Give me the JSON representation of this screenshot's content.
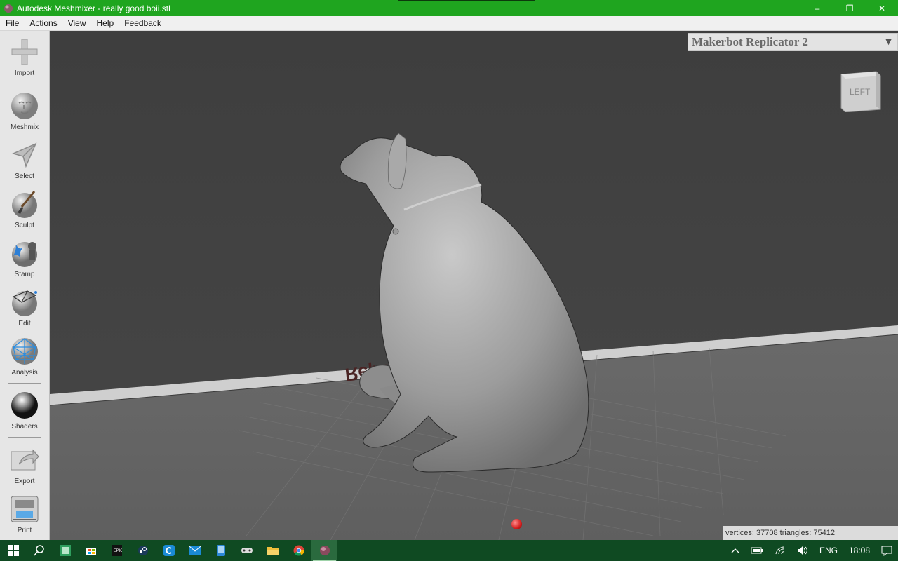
{
  "window": {
    "title": "Autodesk Meshmixer - really good boii.stl",
    "minimize": "–",
    "restore": "❐",
    "close": "✕"
  },
  "menu": [
    "File",
    "Actions",
    "View",
    "Help",
    "Feedback"
  ],
  "toolbar": {
    "tools": [
      "Import",
      "Meshmix",
      "Select",
      "Sculpt",
      "Stamp",
      "Edit",
      "Analysis",
      "Shaders",
      "Export",
      "Print"
    ]
  },
  "viewport": {
    "printer": "Makerbot Replicator 2",
    "printer_arrow": "▼",
    "view_cube_label": "LEFT",
    "bed_text": "Replicator 2",
    "stats": "vertices: 37708 triangles: 75412"
  },
  "taskbar": {
    "language": "ENG",
    "time": "18:08"
  },
  "colors": {
    "titlebar": "#1fa51f",
    "taskbar": "#0f4a22",
    "viewport_bg": "#424242",
    "model": "#9a9a9a"
  }
}
